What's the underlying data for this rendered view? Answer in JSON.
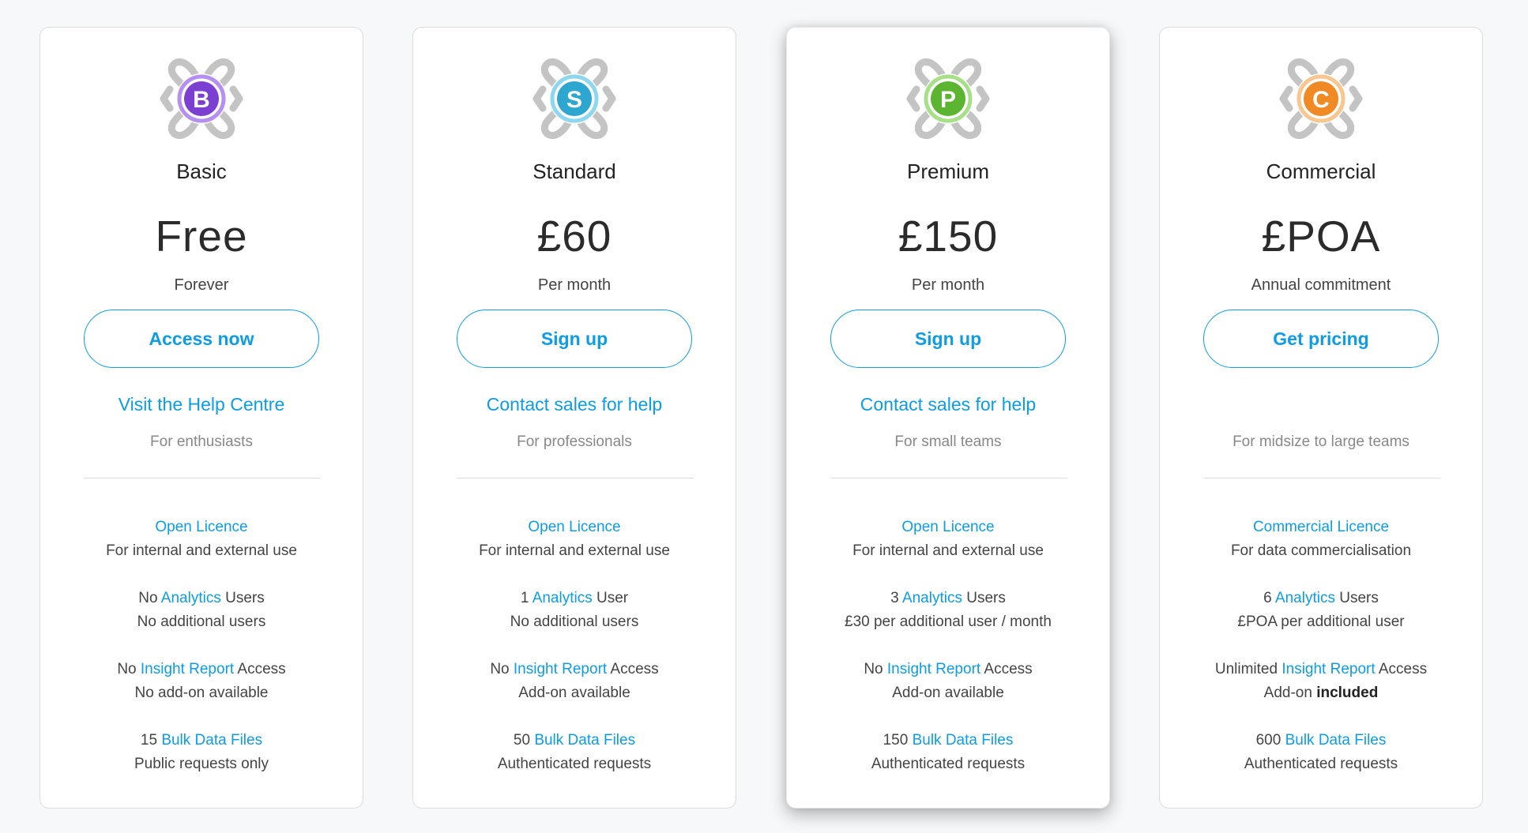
{
  "tiers": [
    {
      "logo_letter": "B",
      "logo_color": "#7b3fd1",
      "logo_color_light": "#b690f0",
      "name": "Basic",
      "price": "Free",
      "period": "Forever",
      "cta_label": "Access now",
      "help_link": "Visit the Help Centre",
      "audience": "For enthusiasts",
      "licence_link": "Open Licence",
      "licence_desc": "For internal and external use",
      "analytics_pre": "No ",
      "analytics_link": "Analytics",
      "analytics_post": " Users",
      "users_desc": "No additional users",
      "insight_pre": "No ",
      "insight_link": "Insight Report",
      "insight_post": " Access",
      "addon_pre": "No add-on available",
      "addon_bold": "",
      "bulk_pre": "15 ",
      "bulk_link": "Bulk Data Files",
      "bulk_desc": "Public requests only"
    },
    {
      "logo_letter": "S",
      "logo_color": "#2da7cf",
      "logo_color_light": "#8fd6ef",
      "name": "Standard",
      "price": "£60",
      "period": "Per month",
      "cta_label": "Sign up",
      "help_link": "Contact sales for help",
      "audience": "For professionals",
      "licence_link": "Open Licence",
      "licence_desc": "For internal and external use",
      "analytics_pre": "1 ",
      "analytics_link": "Analytics",
      "analytics_post": " User",
      "users_desc": "No additional users",
      "insight_pre": "No ",
      "insight_link": "Insight Report",
      "insight_post": " Access",
      "addon_pre": "Add-on available",
      "addon_bold": "",
      "bulk_pre": "50 ",
      "bulk_link": "Bulk Data Files",
      "bulk_desc": "Authenticated requests"
    },
    {
      "logo_letter": "P",
      "logo_color": "#5cb531",
      "logo_color_light": "#a8e08a",
      "name": "Premium",
      "price": "£150",
      "period": "Per month",
      "cta_label": "Sign up",
      "help_link": "Contact sales for help",
      "audience": "For small teams",
      "licence_link": "Open Licence",
      "licence_desc": "For internal and external use",
      "analytics_pre": "3 ",
      "analytics_link": "Analytics",
      "analytics_post": " Users",
      "users_desc": "£30 per additional user / month",
      "insight_pre": "No ",
      "insight_link": "Insight Report",
      "insight_post": " Access",
      "addon_pre": "Add-on available",
      "addon_bold": "",
      "bulk_pre": "150 ",
      "bulk_link": "Bulk Data Files",
      "bulk_desc": "Authenticated requests"
    },
    {
      "logo_letter": "C",
      "logo_color": "#f08a25",
      "logo_color_light": "#f8c68f",
      "name": "Commercial",
      "price": "£POA",
      "period": "Annual commitment",
      "cta_label": "Get pricing",
      "help_link": "",
      "audience": "For midsize to large teams",
      "licence_link": "Commercial Licence",
      "licence_desc": "For data commercialisation",
      "analytics_pre": "6 ",
      "analytics_link": "Analytics",
      "analytics_post": " Users",
      "users_desc": "£POA per additional user",
      "insight_pre": "Unlimited ",
      "insight_link": "Insight Report",
      "insight_post": " Access",
      "addon_pre": "Add-on ",
      "addon_bold": "included",
      "bulk_pre": "600 ",
      "bulk_link": "Bulk Data Files",
      "bulk_desc": "Authenticated requests"
    }
  ],
  "colors": {
    "accent": "#0d9ce6",
    "card_border": "#dcdcdc",
    "logo_frame": "#c4c4c4"
  },
  "featured_tier": "Premium"
}
